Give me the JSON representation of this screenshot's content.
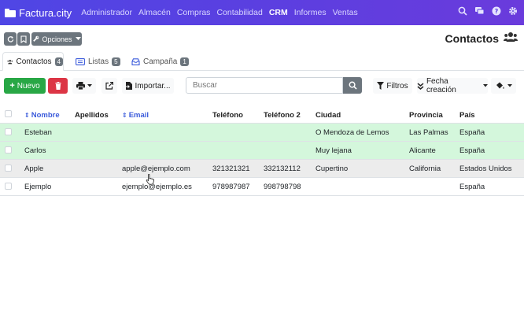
{
  "navbar": {
    "brand": "Factura.city",
    "menu": [
      {
        "label": "Administrador"
      },
      {
        "label": "Almacén"
      },
      {
        "label": "Compras"
      },
      {
        "label": "Contabilidad"
      },
      {
        "label": "CRM",
        "active": true
      },
      {
        "label": "Informes"
      },
      {
        "label": "Ventas"
      }
    ],
    "icons": [
      "search-icon",
      "chat-icon",
      "help-icon",
      "gear-icon"
    ]
  },
  "toolbar": {
    "refresh_icon": "refresh-icon",
    "bookmark_icon": "bookmark-icon",
    "options_label": "Opciones",
    "page_title": "Contactos",
    "page_icon": "users-icon"
  },
  "tabs": [
    {
      "label": "Contactos",
      "count": "4",
      "icon": "users-icon",
      "active": true
    },
    {
      "label": "Listas",
      "count": "5",
      "icon": "list-card-icon"
    },
    {
      "label": "Campaña",
      "count": "1",
      "icon": "inbox-icon"
    }
  ],
  "actions": {
    "new_label": "Nuevo",
    "import_label": "Importar...",
    "search_placeholder": "Buscar",
    "filters_label": "Filtros",
    "sort_label": "Fecha creación"
  },
  "table": {
    "columns": [
      "Nombre",
      "Apellidos",
      "Email",
      "Teléfono",
      "Teléfono 2",
      "Ciudad",
      "Provincia",
      "País"
    ],
    "rows": [
      {
        "nombre": "Esteban",
        "apellidos": "",
        "email": "",
        "telefono": "",
        "telefono2": "",
        "ciudad": "O Mendoza de Lemos",
        "provincia": "Las Palmas",
        "pais": "España"
      },
      {
        "nombre": "Carlos",
        "apellidos": "",
        "email": "",
        "telefono": "",
        "telefono2": "",
        "ciudad": "Muy lejana",
        "provincia": "Alicante",
        "pais": "España"
      },
      {
        "nombre": "Apple",
        "apellidos": "",
        "email": "apple@ejemplo.com",
        "telefono": "321321321",
        "telefono2": "332132112",
        "ciudad": "Cupertino",
        "provincia": "California",
        "pais": "Estados Unidos"
      },
      {
        "nombre": "Ejemplo",
        "apellidos": "",
        "email": "ejemplo@ejemplo.es",
        "telefono": "978987987",
        "telefono2": "998798798",
        "ciudad": "",
        "provincia": "",
        "pais": "España"
      }
    ]
  },
  "colors": {
    "navbar": "#5b3fe0",
    "success": "#28a745",
    "danger": "#dc3545",
    "secondary": "#6c757d",
    "row_highlight_green": "#d4f7dc",
    "row_hover": "#ececec",
    "link": "#3b5bdb"
  }
}
